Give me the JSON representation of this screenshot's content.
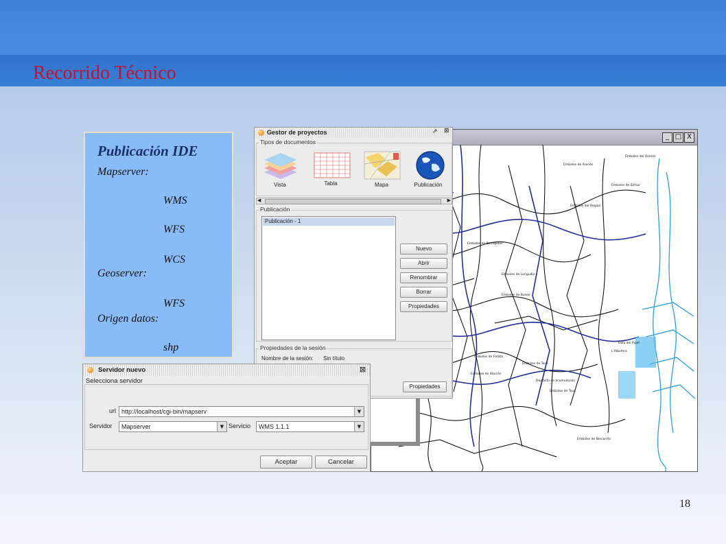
{
  "slide": {
    "title": "Recorrido Técnico",
    "page_number": "18"
  },
  "info_panel": {
    "title": "Publicación IDE",
    "lines": [
      "Mapserver:",
      "WMS",
      "WFS",
      "WCS",
      "Geoserver:",
      "WFS",
      "Origen datos:",
      "shp"
    ]
  },
  "map_window": {
    "buttons": [
      "_",
      "□",
      "X"
    ]
  },
  "project_manager": {
    "title": "Gestor de proyectos",
    "doc_types_label": "Tipos de documentos",
    "doc_types": [
      "Vista",
      "Tabla",
      "Mapa",
      "Publicación"
    ],
    "publication_label": "Publicación",
    "publications": [
      "Publicación - 1"
    ],
    "buttons": {
      "new": "Nuevo",
      "open": "Abrir",
      "rename": "Renombrar",
      "delete": "Borrar",
      "properties": "Propiedades"
    },
    "session_label": "Propiedades de la sesión",
    "session_name_label": "Nombre de la sesión:",
    "session_name_value": "Sin título",
    "session_properties_button": "Propiedades"
  },
  "server_dialog": {
    "title": "Servidor nuevo",
    "section_label": "Selecciona servidor",
    "url_label": "url",
    "url_value": "http://localhost/cgi-bin/mapserv",
    "server_label": "Servidor",
    "server_value": "Mapserver",
    "service_label": "Servicio",
    "service_value": "WMS 1.1.1",
    "accept": "Aceptar",
    "cancel": "Cancelar"
  },
  "colors": {
    "header": "#3a7fd6",
    "title_red": "#c8102e",
    "info_panel": "#89bbf7"
  }
}
